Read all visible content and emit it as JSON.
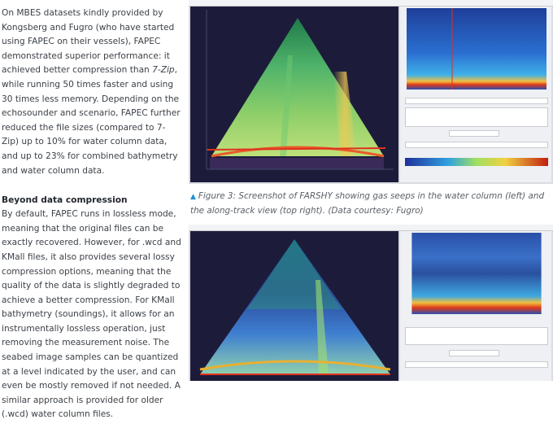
{
  "article": {
    "para1": {
      "before": "On MBES datasets kindly provided by Kongsberg and Fugro (who have started using FAPEC on their vessels), FAPEC demonstrated superior performance: it achieved better compression than ",
      "em": "7-Zip",
      "after": ", while running 50 times faster and using 30 times less memory. Depending on the echosounder and scenario, FAPEC further reduced the file sizes (compared to 7-Zip) up to 10% for water column data, and up to 23% for combined bathymetry and water column data."
    },
    "heading": "Beyond data compression",
    "para2": "By default, FAPEC runs in lossless mode, meaning that the original files can be exactly recovered. However, for .wcd and KMall files, it also provides several lossy compression options, meaning that the quality of the data is slightly degraded to achieve a better compression. For KMall bathymetry (soundings), it allows for an instrumentally lossless operation, just removing the measurement noise. The seabed image samples can be quantized at a level indicated by the user, and can even be mostly removed if not needed. A similar approach is provided for older (.wcd) water column files."
  },
  "figure3": {
    "caption": "Figure 3: Screenshot of FARSHY showing gas seeps in the water column (left) and the along-track view (top right). (Data courtesy: Fugro)"
  },
  "figure4": {},
  "colors": {
    "text": "#3c4147",
    "caption": "#5a5f66",
    "caption_marker": "#1e8fd0",
    "plot_background": "#1c1c3a",
    "accent_red": "#e0301e"
  },
  "icons": {
    "caption_marker": "triangle-up-icon"
  }
}
